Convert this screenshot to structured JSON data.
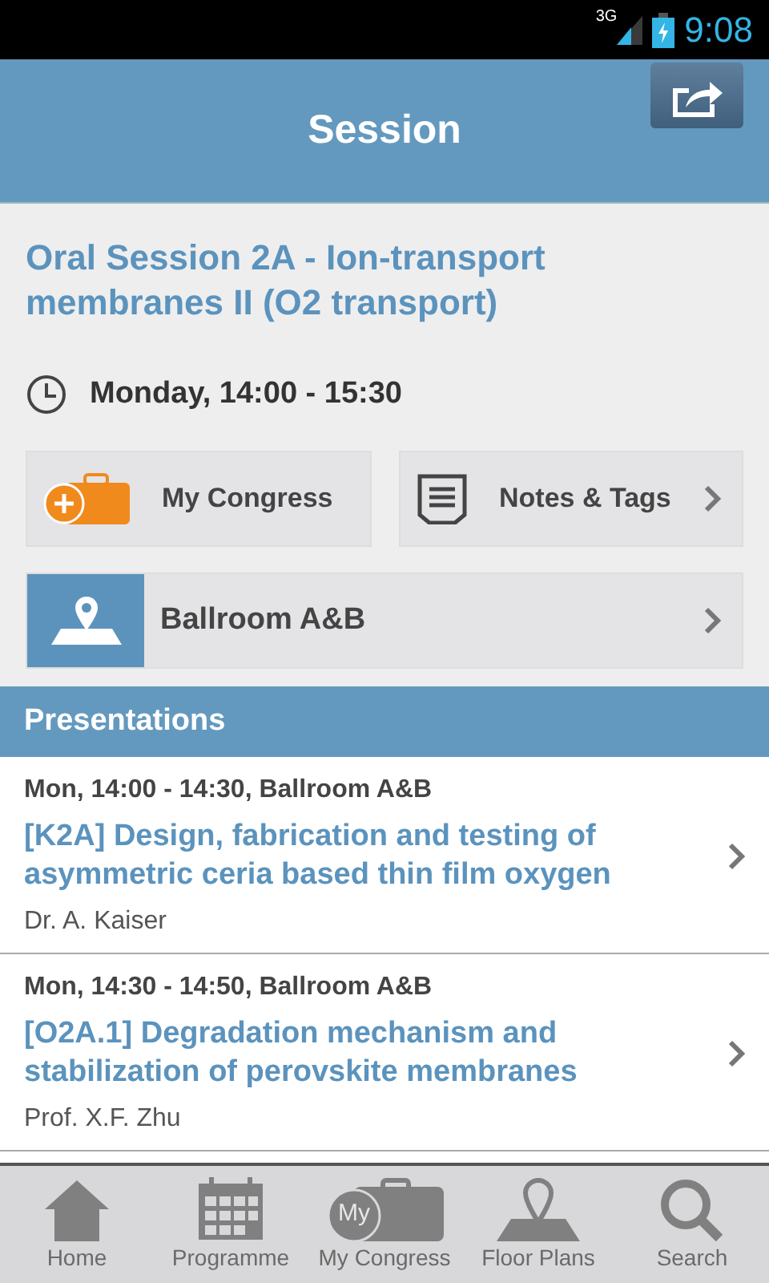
{
  "status_bar": {
    "network": "3G",
    "time": "9:08"
  },
  "header": {
    "title": "Session"
  },
  "session": {
    "title": "Oral Session 2A - Ion-transport membranes II (O2 transport)",
    "time": "Monday, 14:00 - 15:30"
  },
  "actions": [
    {
      "label": "My Congress",
      "kind": "congress"
    },
    {
      "label": "Notes & Tags",
      "kind": "notes"
    }
  ],
  "room": {
    "label": "Ballroom A&B"
  },
  "presentations": {
    "heading": "Presentations",
    "items": [
      {
        "time": "Mon, 14:00 - 14:30, Ballroom A&B",
        "title": "[K2A] Design, fabrication and testing of asymmetric ceria based thin film oxygen",
        "speaker": "Dr. A. Kaiser"
      },
      {
        "time": "Mon, 14:30 - 14:50, Ballroom A&B",
        "title": "[O2A.1] Degradation mechanism and stabilization of perovskite membranes",
        "speaker": "Prof. X.F. Zhu"
      }
    ]
  },
  "tab_bar": [
    {
      "label": "Home"
    },
    {
      "label": "Programme"
    },
    {
      "label": "My Congress",
      "badge": "My"
    },
    {
      "label": "Floor Plans"
    },
    {
      "label": "Search"
    }
  ]
}
